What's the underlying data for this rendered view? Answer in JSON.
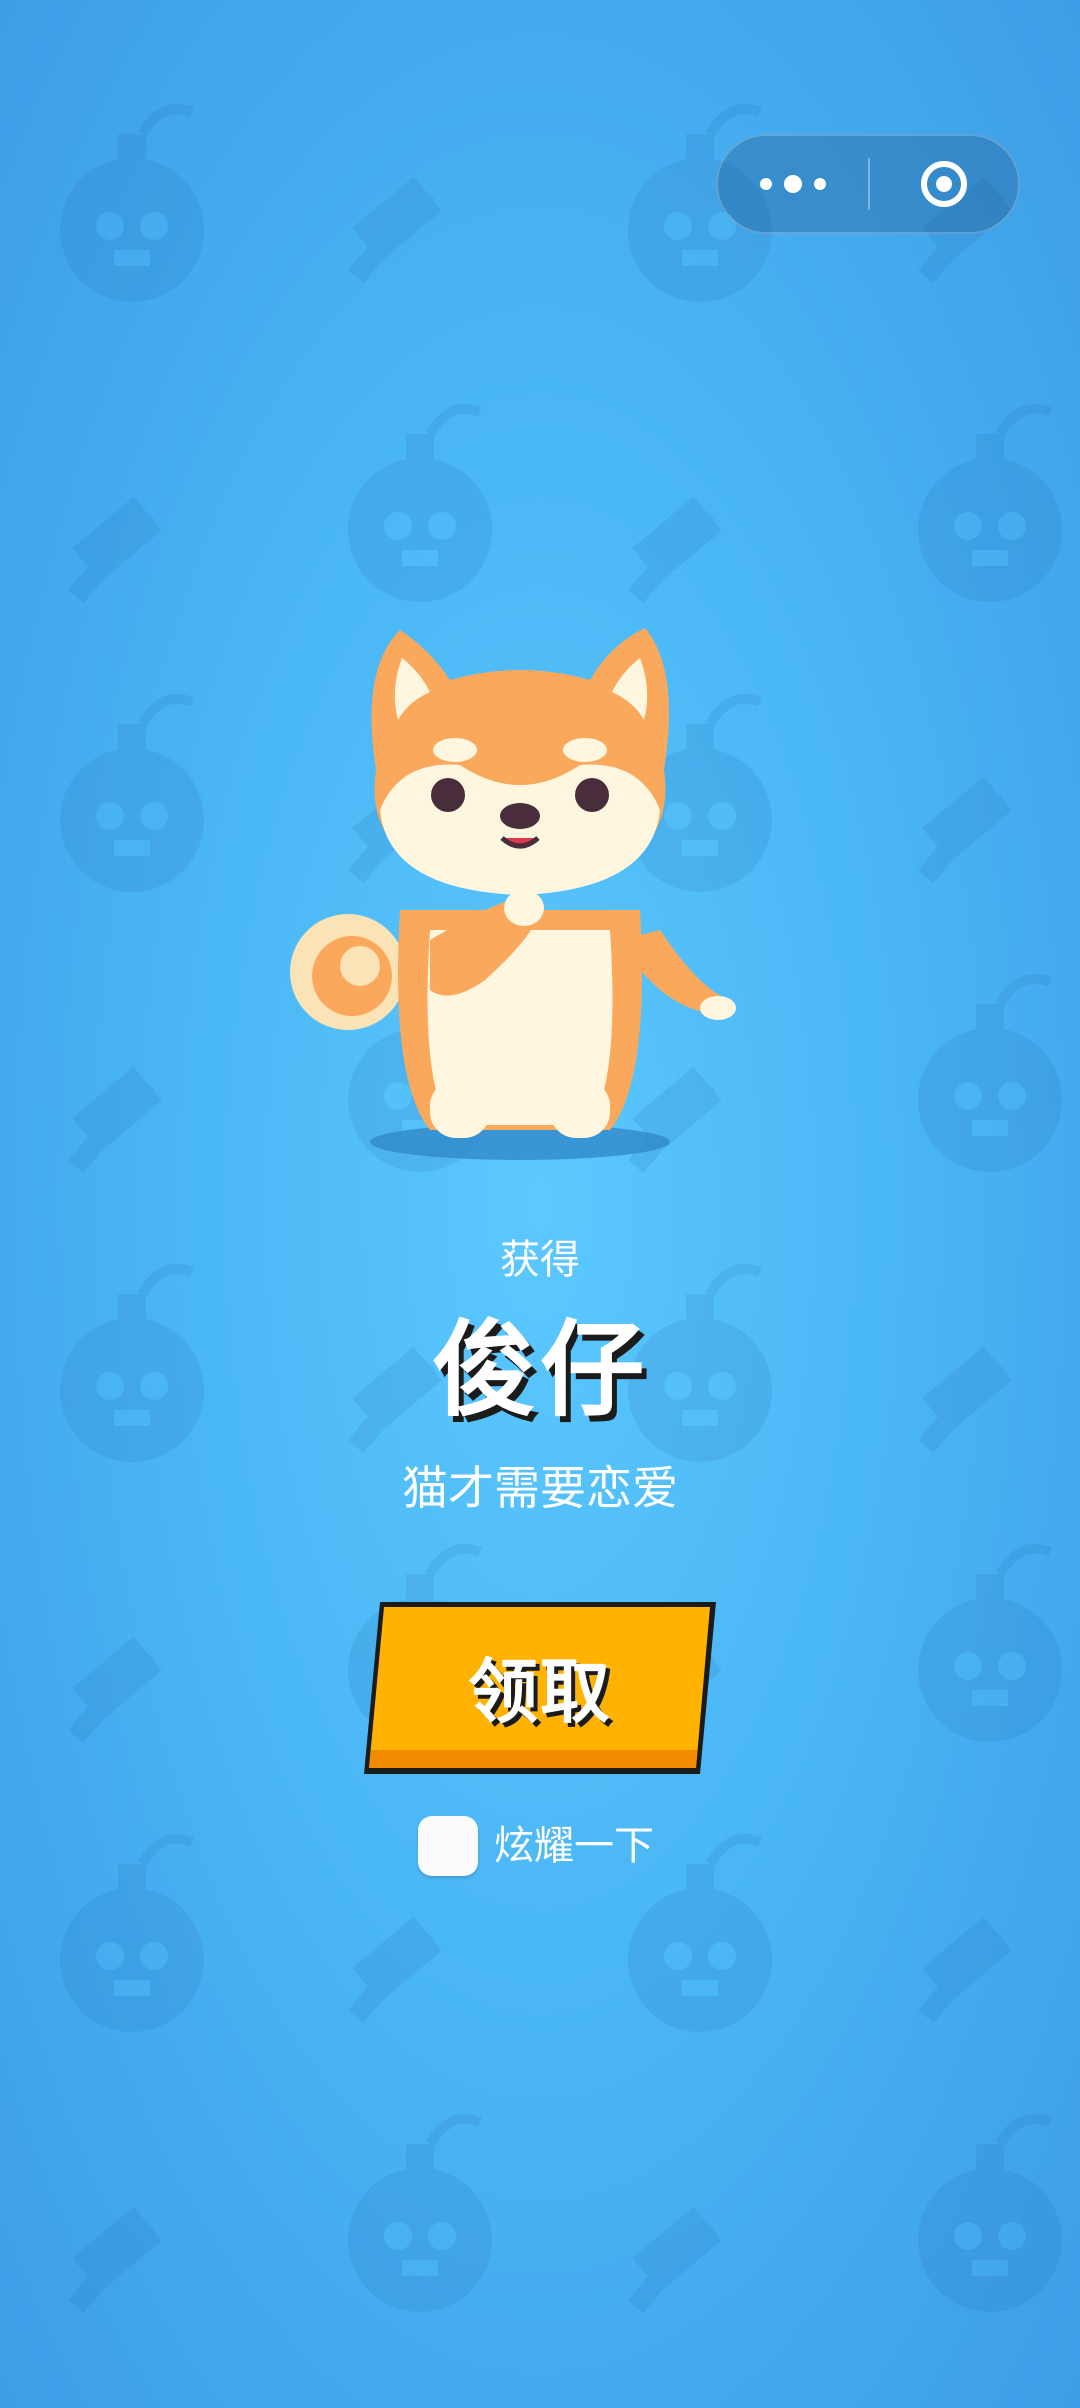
{
  "header": {
    "more_icon": "more-dots-icon",
    "close_icon": "target-close-icon"
  },
  "reward": {
    "label": "获得",
    "name": "俊仔",
    "subtitle": "猫才需要恋爱",
    "image_icon": "shiba-dog-icon"
  },
  "actions": {
    "claim_label": "领取",
    "share_label": "炫耀一下",
    "share_checked": false
  },
  "colors": {
    "background": "#4ab7f5",
    "button": "#ffb300",
    "button_border": "#1b1b1b",
    "dog_orange": "#f9a85c",
    "dog_cream": "#fff6df"
  }
}
